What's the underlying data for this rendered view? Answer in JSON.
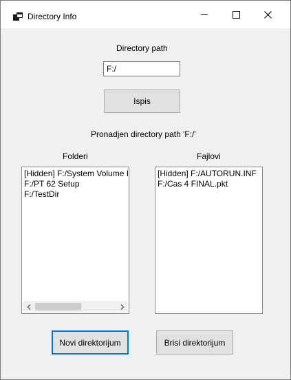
{
  "window": {
    "title": "Directory Info",
    "icon": "app-window-icon",
    "controls": [
      "minimize-icon",
      "maximize-icon",
      "close-icon"
    ]
  },
  "form": {
    "path_label": "Directory path",
    "path_value": "F:/",
    "list_button": "Ispis",
    "status_text": "Pronadjen directory path 'F:/'"
  },
  "folders": {
    "header": "Folderi",
    "items": [
      "[Hidden] F:/System Volume I",
      "F:/PT 62 Setup",
      "F:/TestDir"
    ]
  },
  "files": {
    "header": "Fajlovi",
    "items": [
      "[Hidden] F:/AUTORUN.INF",
      "F:/Cas 4 FINAL.pkt"
    ]
  },
  "actions": {
    "new_dir": "Novi direktorijum",
    "delete_dir": "Brisi direktorijum"
  },
  "colors": {
    "accent": "#0078d7",
    "window_bg": "#f0f0f0",
    "button_bg": "#e1e1e1"
  }
}
